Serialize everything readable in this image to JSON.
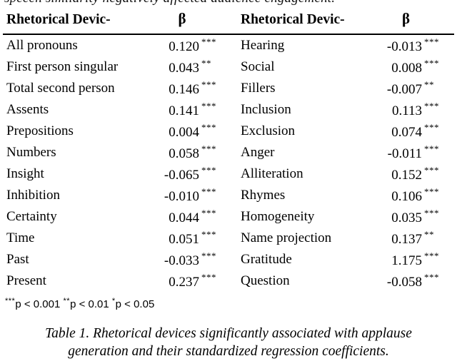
{
  "page": {
    "clipped_top_line": "speech similarity negatively affected audience engagement."
  },
  "table": {
    "headers": {
      "label_left": "Rhetorical Devic-",
      "beta_left": "β",
      "label_right": "Rhetorical Devic-",
      "beta_right": "β"
    },
    "rows": [
      {
        "left_label": "All pronouns",
        "left_beta": "0.120",
        "left_sig": "***",
        "right_label": "Hearing",
        "right_beta": "-0.013",
        "right_sig": "***"
      },
      {
        "left_label": "First person singular",
        "left_beta": "0.043",
        "left_sig": "**",
        "right_label": "Social",
        "right_beta": "0.008",
        "right_sig": "***"
      },
      {
        "left_label": "Total second person",
        "left_beta": "0.146",
        "left_sig": "***",
        "right_label": "Fillers",
        "right_beta": "-0.007",
        "right_sig": "**"
      },
      {
        "left_label": "Assents",
        "left_beta": "0.141",
        "left_sig": "***",
        "right_label": "Inclusion",
        "right_beta": "0.113",
        "right_sig": "***"
      },
      {
        "left_label": "Prepositions",
        "left_beta": "0.004",
        "left_sig": "***",
        "right_label": "Exclusion",
        "right_beta": "0.074",
        "right_sig": "***"
      },
      {
        "left_label": "Numbers",
        "left_beta": "0.058",
        "left_sig": "***",
        "right_label": "Anger",
        "right_beta": "-0.011",
        "right_sig": "***"
      },
      {
        "left_label": "Insight",
        "left_beta": "-0.065",
        "left_sig": "***",
        "right_label": "Alliteration",
        "right_beta": "0.152",
        "right_sig": "***"
      },
      {
        "left_label": "Inhibition",
        "left_beta": "-0.010",
        "left_sig": "***",
        "right_label": "Rhymes",
        "right_beta": "0.106",
        "right_sig": "***"
      },
      {
        "left_label": "Certainty",
        "left_beta": "0.044",
        "left_sig": "***",
        "right_label": "Homogeneity",
        "right_beta": "0.035",
        "right_sig": "***"
      },
      {
        "left_label": "Time",
        "left_beta": "0.051",
        "left_sig": "***",
        "right_label": "Name projection",
        "right_beta": "0.137",
        "right_sig": "**"
      },
      {
        "left_label": "Past",
        "left_beta": "-0.033",
        "left_sig": "***",
        "right_label": "Gratitude",
        "right_beta": "1.175",
        "right_sig": "***"
      },
      {
        "left_label": "Present",
        "left_beta": "0.237",
        "left_sig": "***",
        "right_label": "Question",
        "right_beta": "-0.058",
        "right_sig": "***"
      }
    ]
  },
  "footnote": {
    "s3": "***",
    "p3": "p < 0.001",
    "s2": "**",
    "p2": "p < 0.01",
    "s1": "*",
    "p1": "p < 0.05"
  },
  "caption": {
    "line1": "Table 1. Rhetorical devices significantly associated with applause",
    "line2": "generation and their standardized regression coefficients."
  }
}
